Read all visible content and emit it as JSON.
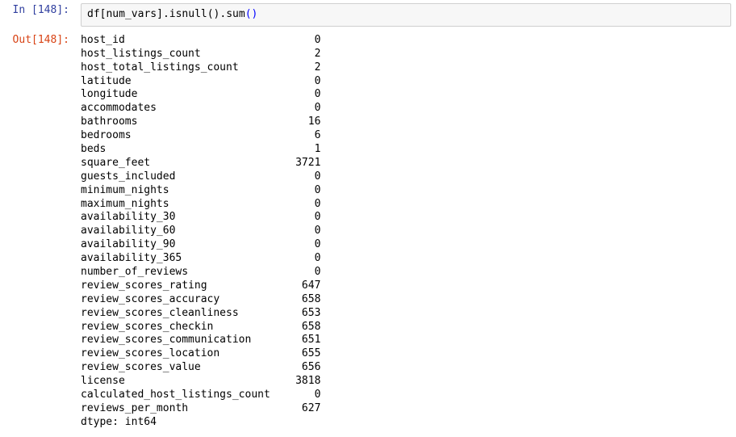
{
  "input": {
    "prompt_label": "In [148]:",
    "code_tokens": [
      {
        "t": "df",
        "cls": "cm-var"
      },
      {
        "t": "[",
        "cls": "cm-bracket"
      },
      {
        "t": "num_vars",
        "cls": "cm-var"
      },
      {
        "t": "]",
        "cls": "cm-bracket"
      },
      {
        "t": ".",
        "cls": "cm-prop"
      },
      {
        "t": "isnull",
        "cls": "cm-func"
      },
      {
        "t": "()",
        "cls": "cm-bracket"
      },
      {
        "t": ".",
        "cls": "cm-prop"
      },
      {
        "t": "sum",
        "cls": "cm-func"
      },
      {
        "t": "()",
        "cls": "cm-paren-call"
      }
    ]
  },
  "output": {
    "prompt_label": "Out[148]:",
    "series": [
      {
        "name": "host_id",
        "value": 0
      },
      {
        "name": "host_listings_count",
        "value": 2
      },
      {
        "name": "host_total_listings_count",
        "value": 2
      },
      {
        "name": "latitude",
        "value": 0
      },
      {
        "name": "longitude",
        "value": 0
      },
      {
        "name": "accommodates",
        "value": 0
      },
      {
        "name": "bathrooms",
        "value": 16
      },
      {
        "name": "bedrooms",
        "value": 6
      },
      {
        "name": "beds",
        "value": 1
      },
      {
        "name": "square_feet",
        "value": 3721
      },
      {
        "name": "guests_included",
        "value": 0
      },
      {
        "name": "minimum_nights",
        "value": 0
      },
      {
        "name": "maximum_nights",
        "value": 0
      },
      {
        "name": "availability_30",
        "value": 0
      },
      {
        "name": "availability_60",
        "value": 0
      },
      {
        "name": "availability_90",
        "value": 0
      },
      {
        "name": "availability_365",
        "value": 0
      },
      {
        "name": "number_of_reviews",
        "value": 0
      },
      {
        "name": "review_scores_rating",
        "value": 647
      },
      {
        "name": "review_scores_accuracy",
        "value": 658
      },
      {
        "name": "review_scores_cleanliness",
        "value": 653
      },
      {
        "name": "review_scores_checkin",
        "value": 658
      },
      {
        "name": "review_scores_communication",
        "value": 651
      },
      {
        "name": "review_scores_location",
        "value": 655
      },
      {
        "name": "review_scores_value",
        "value": 656
      },
      {
        "name": "license",
        "value": 3818
      },
      {
        "name": "calculated_host_listings_count",
        "value": 0
      },
      {
        "name": "reviews_per_month",
        "value": 627
      }
    ],
    "dtype_line": "dtype: int64",
    "name_col_width": 34,
    "value_col_width": 4
  }
}
